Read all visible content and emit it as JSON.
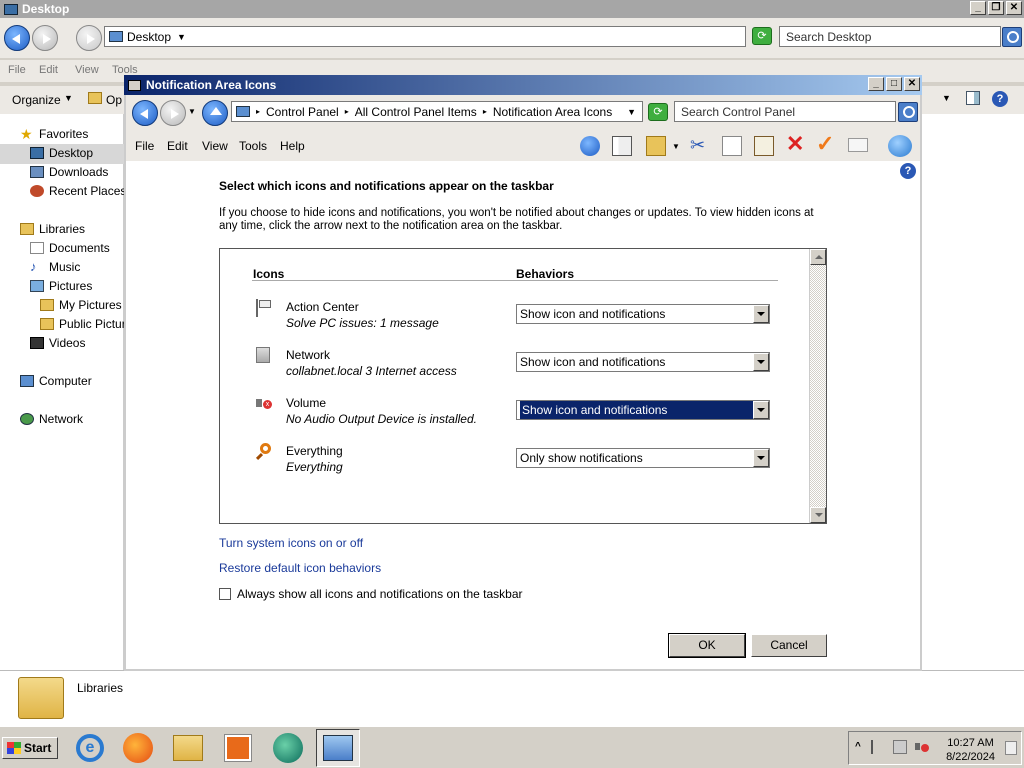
{
  "background": {
    "title": "Desktop",
    "address": "Desktop",
    "search_placeholder": "Search Desktop",
    "menu": [
      "File",
      "Edit",
      "View",
      "Tools",
      "Help"
    ],
    "organize_label": "Organize",
    "open_label": "Op",
    "sidebar": {
      "favorites": "Favorites",
      "desktop": "Desktop",
      "downloads": "Downloads",
      "recent_places": "Recent Places",
      "libraries": "Libraries",
      "documents": "Documents",
      "music": "Music",
      "pictures": "Pictures",
      "my_pictures": "My Pictures",
      "public_pictures": "Public Picture",
      "videos": "Videos",
      "computer": "Computer",
      "network": "Network"
    },
    "details_label": "Libraries"
  },
  "dialog": {
    "title": "Notification Area Icons",
    "breadcrumb": [
      "Control Panel",
      "All Control Panel Items",
      "Notification Area Icons"
    ],
    "search_placeholder": "Search Control Panel",
    "menu": [
      "File",
      "Edit",
      "View",
      "Tools",
      "Help"
    ],
    "heading": "Select which icons and notifications appear on the taskbar",
    "description": "If you choose to hide icons and notifications, you won't be notified about changes or updates. To view hidden icons at any time, click the arrow next to the notification area on the taskbar.",
    "columns": {
      "icons": "Icons",
      "behaviors": "Behaviors"
    },
    "rows": [
      {
        "name": "Action Center",
        "desc": "Solve PC issues: 1 message",
        "behavior": "Show icon and notifications",
        "icon": "flag-icon"
      },
      {
        "name": "Network",
        "desc": "collabnet.local  3 Internet access",
        "behavior": "Show icon and notifications",
        "icon": "network-icon"
      },
      {
        "name": "Volume",
        "desc": "No Audio Output Device is installed.",
        "behavior": "Show icon and notifications",
        "icon": "volume-muted-icon"
      },
      {
        "name": "Everything",
        "desc": "Everything",
        "behavior": "Only show notifications",
        "icon": "magnifier-icon"
      }
    ],
    "link_system_icons": "Turn system icons on or off",
    "link_restore": "Restore default icon behaviors",
    "checkbox_label": "Always show all icons and notifications on the taskbar",
    "checkbox_checked": false,
    "ok_label": "OK",
    "cancel_label": "Cancel"
  },
  "taskbar": {
    "start_label": "Start",
    "time": "10:27 AM",
    "date": "8/22/2024",
    "apps": [
      "internet-explorer-icon",
      "firefox-icon",
      "explorer-icon",
      "media-player-icon",
      "green-app-icon",
      "control-panel-icon"
    ]
  },
  "colors": {
    "title_active": "#0a246a",
    "title_gradient_end": "#a6caf0",
    "link": "#1a3a9a",
    "selection": "#0a246a"
  }
}
